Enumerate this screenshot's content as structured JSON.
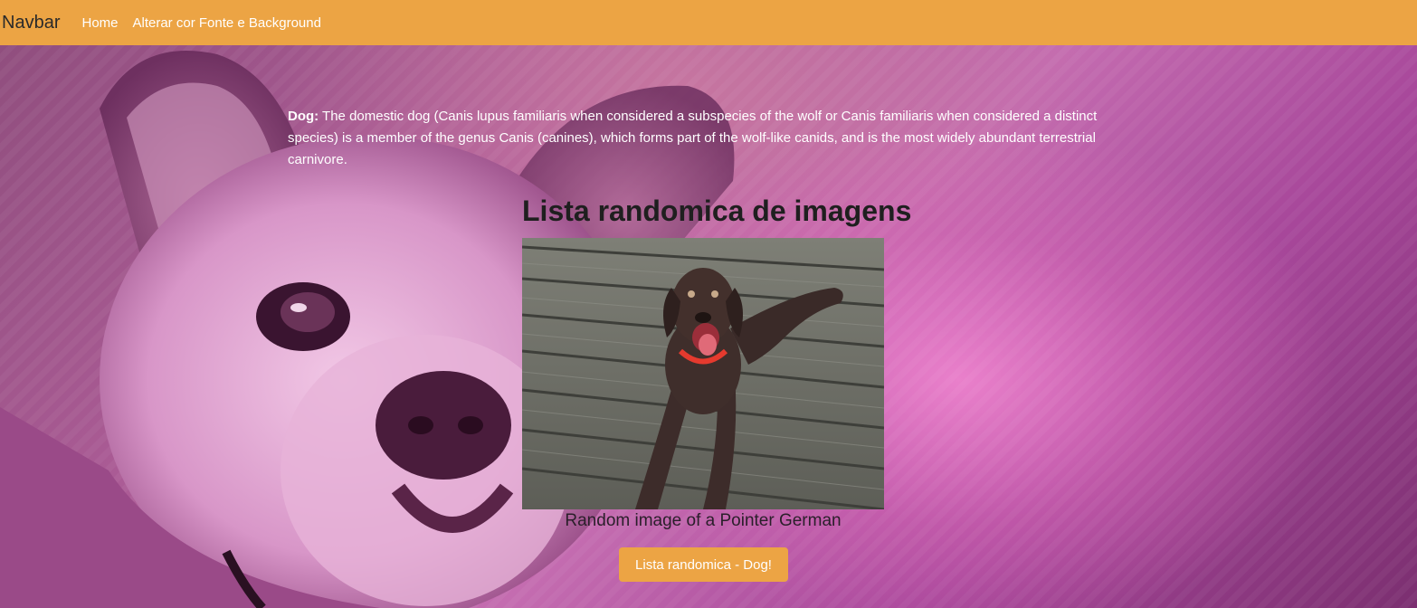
{
  "navbar": {
    "brand": "Navbar",
    "links": [
      "Home",
      "Alterar cor Fonte e Background"
    ],
    "color": "#eca444"
  },
  "description": {
    "label": "Dog:",
    "text": " The domestic dog (Canis lupus familiaris when considered a subspecies of the wolf or Canis familiaris when considered a distinct species) is a member of the genus Canis (canines), which forms part of the wolf-like canids, and is the most widely abundant terrestrial carnivore."
  },
  "gallery": {
    "title": "Lista randomica de imagens",
    "caption": "Random image of a Pointer German",
    "button_label": "Lista randomica - Dog!"
  },
  "colors": {
    "accent": "#eca444",
    "background": "#b05e9a"
  }
}
